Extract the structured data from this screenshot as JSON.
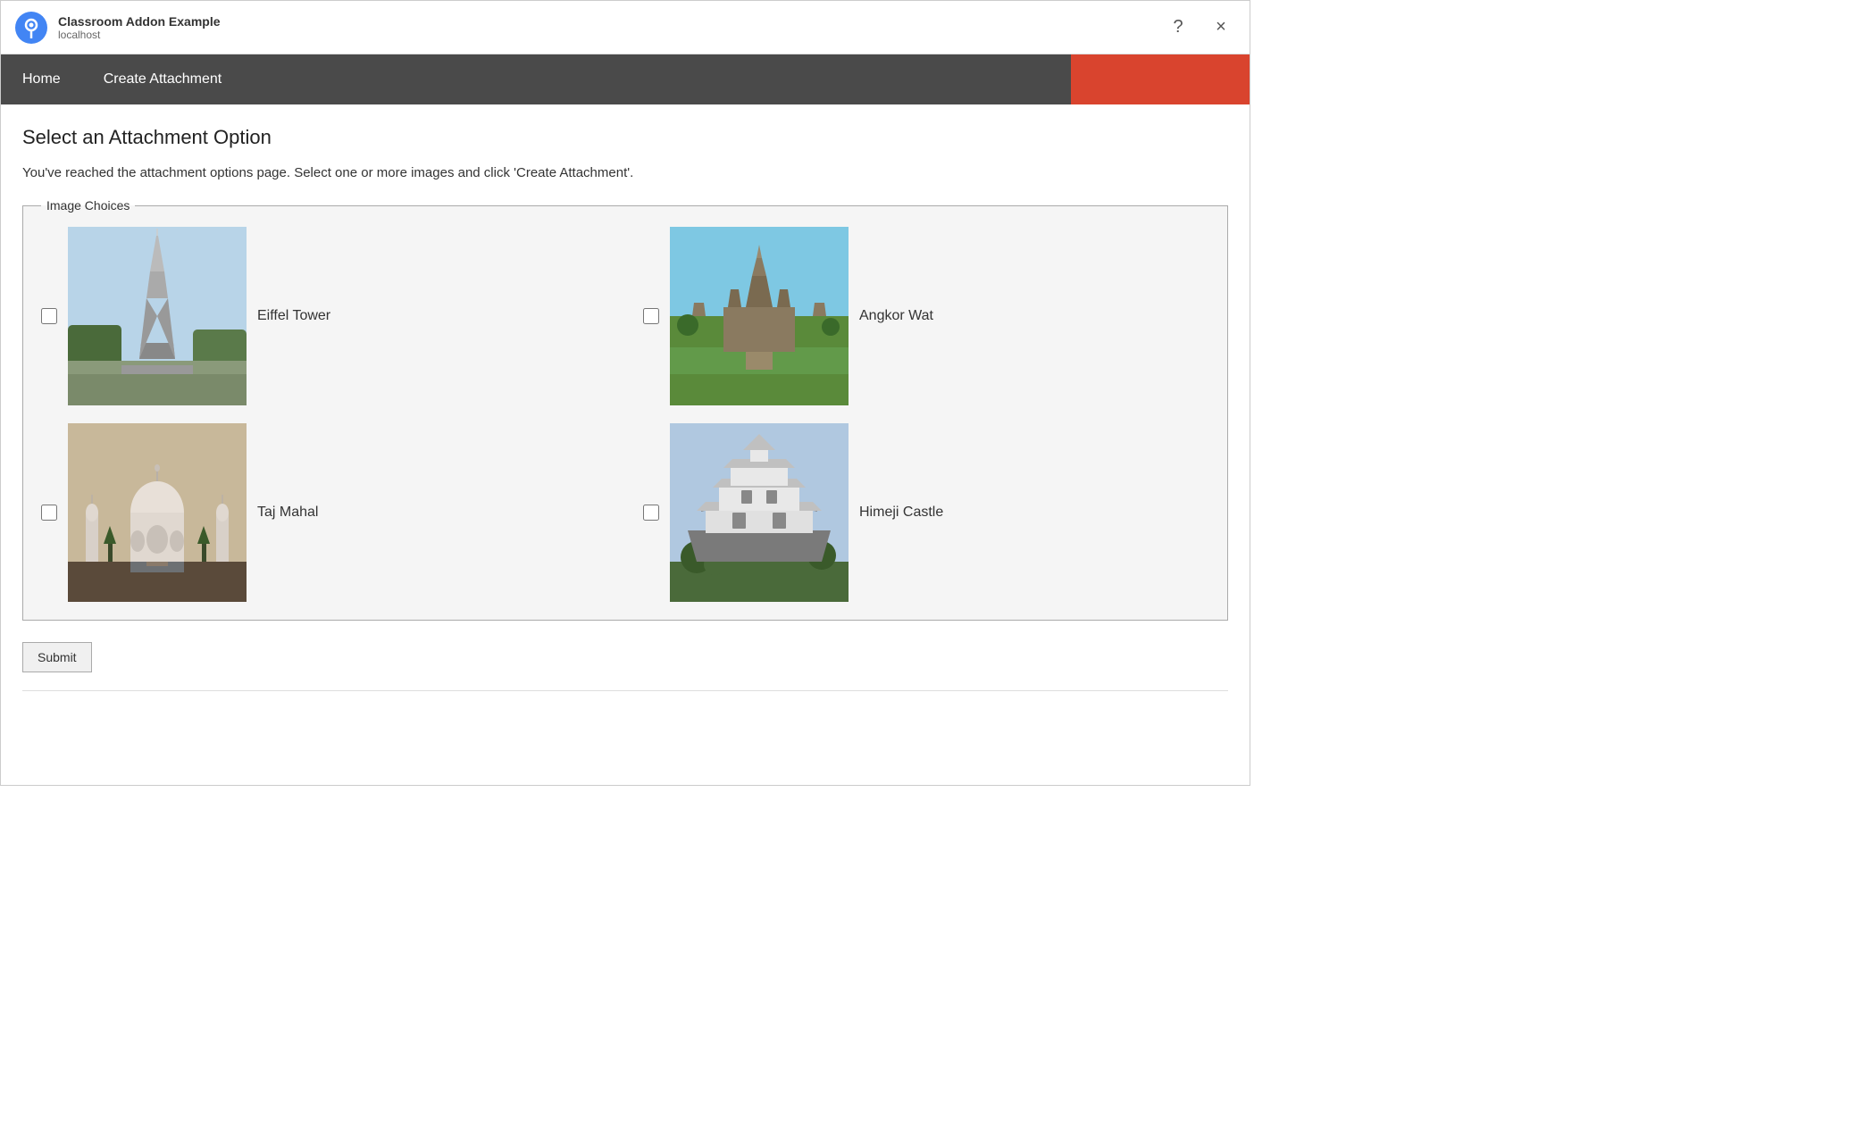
{
  "browser": {
    "app_title": "Classroom Addon Example",
    "app_url": "localhost",
    "help_icon": "?",
    "close_icon": "×"
  },
  "nav": {
    "home_label": "Home",
    "create_attachment_label": "Create Attachment"
  },
  "page": {
    "title": "Select an Attachment Option",
    "description": "You've reached the attachment options page. Select one or more images and click 'Create Attachment'.",
    "fieldset_legend": "Image Choices",
    "submit_label": "Submit"
  },
  "images": [
    {
      "id": "eiffel",
      "label": "Eiffel Tower",
      "class": "img-eiffel"
    },
    {
      "id": "angkor",
      "label": "Angkor Wat",
      "class": "img-angkor"
    },
    {
      "id": "taj",
      "label": "Taj Mahal",
      "class": "img-taj"
    },
    {
      "id": "himeji",
      "label": "Himeji Castle",
      "class": "img-himeji"
    }
  ]
}
